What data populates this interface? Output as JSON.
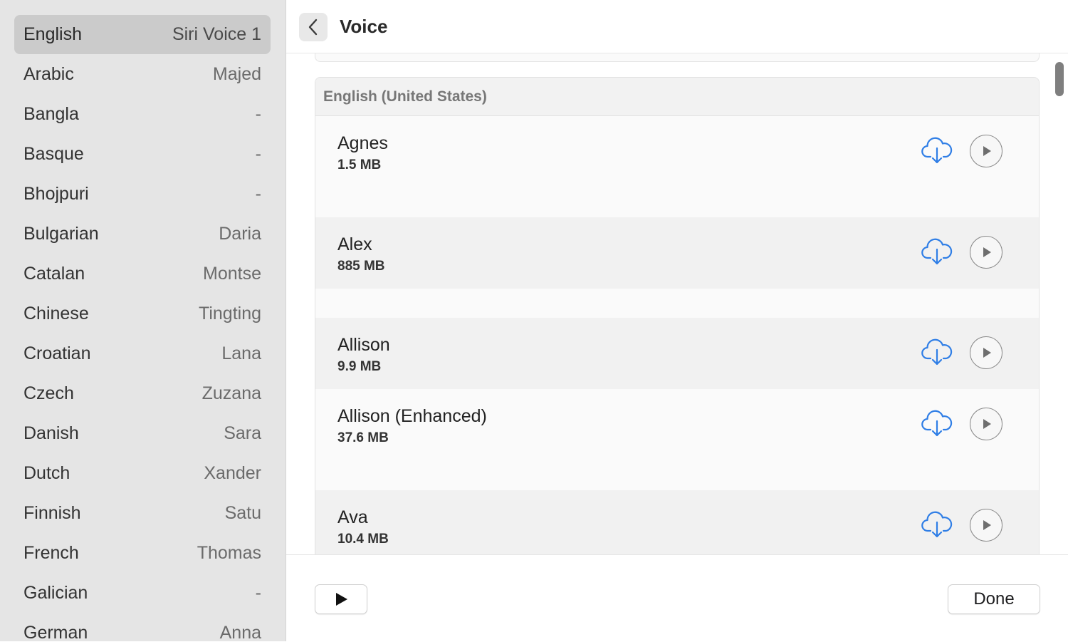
{
  "sidebar": {
    "languages": [
      {
        "language": "English",
        "voice": "Siri Voice 1",
        "selected": true
      },
      {
        "language": "Arabic",
        "voice": "Majed"
      },
      {
        "language": "Bangla",
        "voice": "-"
      },
      {
        "language": "Basque",
        "voice": "-"
      },
      {
        "language": "Bhojpuri",
        "voice": "-"
      },
      {
        "language": "Bulgarian",
        "voice": "Daria"
      },
      {
        "language": "Catalan",
        "voice": "Montse"
      },
      {
        "language": "Chinese",
        "voice": "Tingting"
      },
      {
        "language": "Croatian",
        "voice": "Lana"
      },
      {
        "language": "Czech",
        "voice": "Zuzana"
      },
      {
        "language": "Danish",
        "voice": "Sara"
      },
      {
        "language": "Dutch",
        "voice": "Xander"
      },
      {
        "language": "Finnish",
        "voice": "Satu"
      },
      {
        "language": "French",
        "voice": "Thomas"
      },
      {
        "language": "Galician",
        "voice": "-"
      },
      {
        "language": "German",
        "voice": "Anna"
      }
    ]
  },
  "header": {
    "back_icon": "chevron-left-icon",
    "title": "Voice"
  },
  "group": {
    "title": "English (United States)",
    "voices": [
      {
        "name": "Agnes",
        "size": "1.5 MB"
      },
      {
        "name": "Alex",
        "size": "885 MB"
      },
      {
        "name": "Allison",
        "size": "9.9 MB"
      },
      {
        "name": "Allison (Enhanced)",
        "size": "37.6 MB"
      },
      {
        "name": "Ava",
        "size": "10.4 MB"
      }
    ],
    "download_icon": "cloud-download-icon",
    "play_icon": "play-icon"
  },
  "footer": {
    "play_icon": "play-icon",
    "done_label": "Done"
  },
  "colors": {
    "accent": "#2f7ee6",
    "sidebar_bg": "#e5e5e5",
    "selected_bg": "#cbcbcb"
  }
}
